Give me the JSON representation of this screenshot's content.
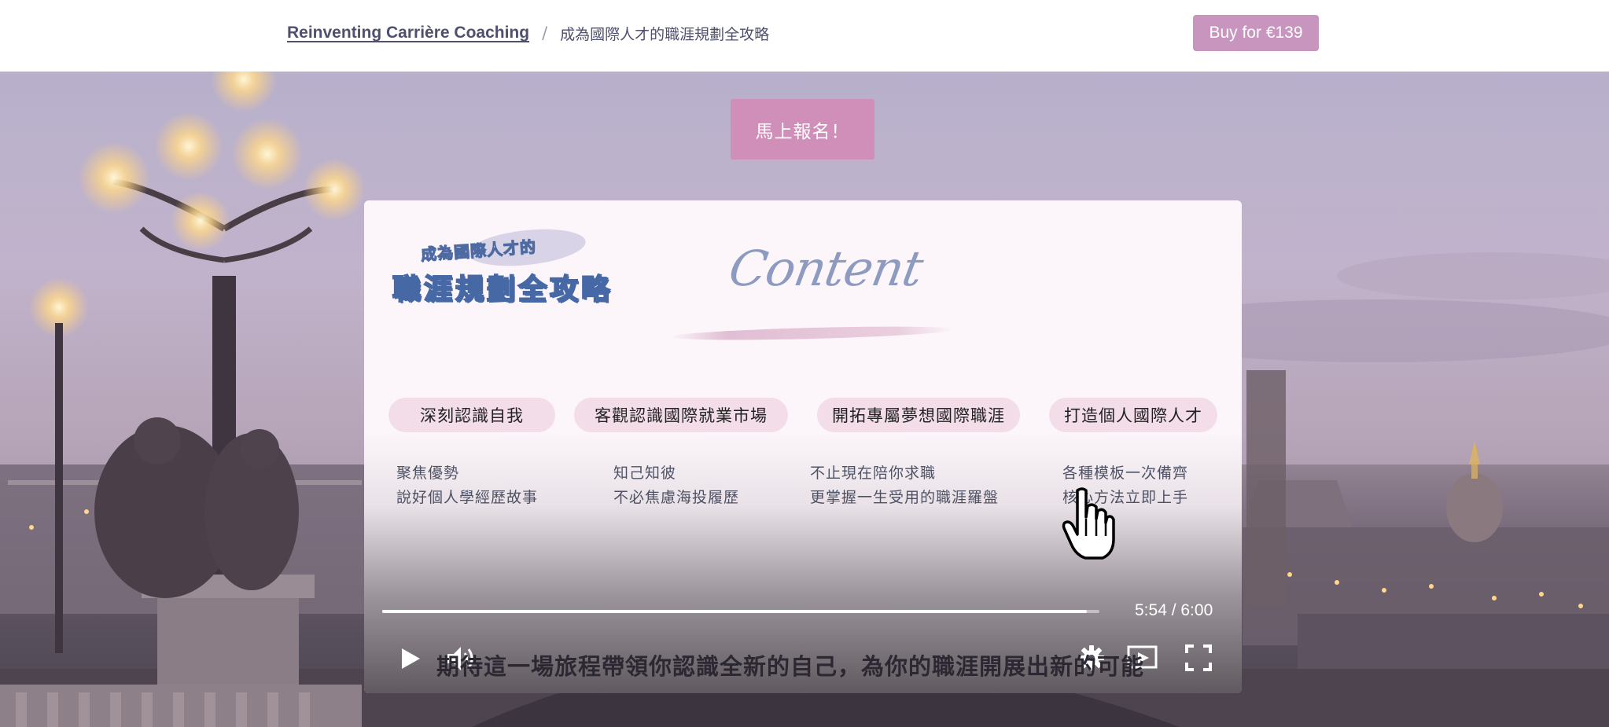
{
  "header": {
    "course_link": "Reinventing Carrière Coaching",
    "separator": "/",
    "current_page": "成為國際人才的職涯規劃全攻略",
    "buy_button": "Buy for €139",
    "buy_color": "#c795be"
  },
  "hero": {
    "enroll_button": "馬上報名！",
    "enroll_color": "#cf8fb8"
  },
  "video": {
    "slide": {
      "logo_small": "成為國際人才的",
      "logo_big": "職涯規劃全攻略",
      "script_title": "Content",
      "topics": [
        {
          "pill": "深刻認識自我",
          "line1": "聚焦優勢",
          "line2": "說好個人學經歷故事"
        },
        {
          "pill": "客觀認識國際就業市場",
          "line1": "知己知彼",
          "line2": "不必焦慮海投履歷"
        },
        {
          "pill": "開拓專屬夢想國際職涯",
          "line1": "不止現在陪你求職",
          "line2": "更掌握一生受用的職涯羅盤"
        },
        {
          "pill": "打造個人國際人才",
          "line1": "各種模板一次備齊",
          "line2": "核心方法立即上手"
        }
      ]
    },
    "subtitle": "期待這一場旅程帶領你認識全新的自己，為你的職涯開展出新的可能",
    "current_time": "5:54",
    "duration": "6:00",
    "time_display": "5:54 / 6:00",
    "progress_fraction": 0.983,
    "icons": [
      "play-icon",
      "volume-icon",
      "settings-icon",
      "cast-icon",
      "fullscreen-icon",
      "hand-cursor-icon"
    ]
  }
}
